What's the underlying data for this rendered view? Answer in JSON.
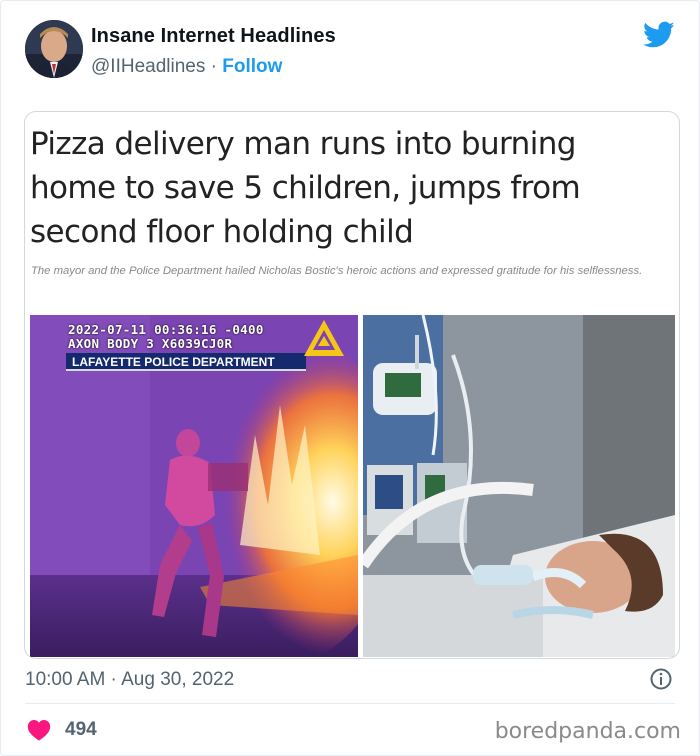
{
  "author": {
    "name": "Insane Internet Headlines",
    "handle": "@IIHeadlines",
    "separator": " · ",
    "follow_label": "Follow"
  },
  "embed": {
    "headline": "Pizza delivery man runs into burning home to save 5 children, jumps from second floor holding child",
    "caption": "The mayor and the Police Department hailed Nicholas Bostic's heroic actions and expressed gratitude for his selflessness.",
    "bodycam_line1": "2022-07-11 00:36:16 -0400",
    "bodycam_line2": "AXON BODY 3 X6039CJ0R",
    "department": "LAFAYETTE POLICE DEPARTMENT"
  },
  "footer": {
    "timestamp": "10:00 AM · Aug 30, 2022",
    "likes": "494",
    "watermark": "boredpanda.com"
  },
  "icons": {
    "brand": "twitter-bird-icon",
    "info": "info-icon",
    "like": "heart-icon"
  },
  "colors": {
    "accent": "#1d9bf0",
    "heart": "#f91880",
    "muted": "#536471"
  }
}
